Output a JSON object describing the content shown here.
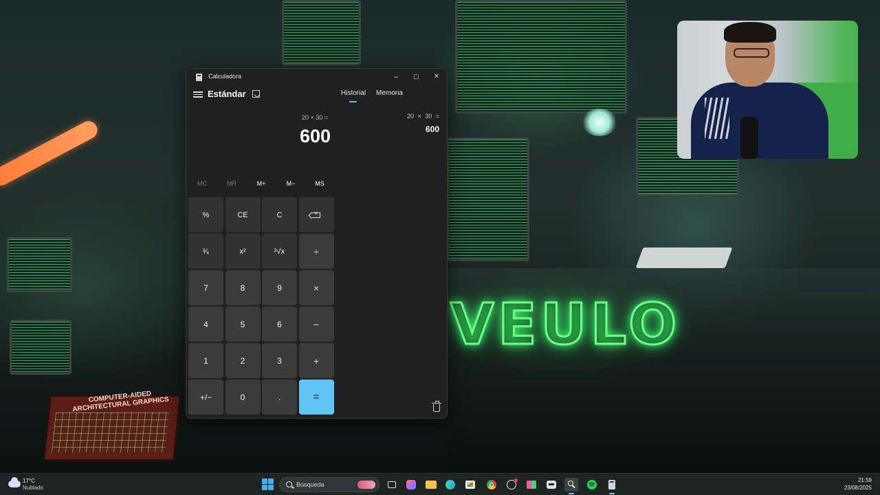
{
  "calculator": {
    "window_title": "Calculadora",
    "window_controls": {
      "minimize": "–",
      "maximize": "☐",
      "close": "✕"
    },
    "mode": "Estándar",
    "tabs": [
      {
        "label": "Historial",
        "active": true
      },
      {
        "label": "Memoria",
        "active": false
      }
    ],
    "expression": "20 × 30 =",
    "display_value": "600",
    "history": [
      {
        "expression": "20 × 30 =",
        "result": "600"
      }
    ],
    "memory_buttons": [
      {
        "label": "MC",
        "enabled": false
      },
      {
        "label": "MR",
        "enabled": false
      },
      {
        "label": "M+",
        "enabled": true
      },
      {
        "label": "M−",
        "enabled": true
      },
      {
        "label": "MS",
        "enabled": true
      }
    ],
    "keys": [
      {
        "label": "%",
        "name": "percent-key",
        "kind": "func"
      },
      {
        "label": "CE",
        "name": "clear-entry-key",
        "kind": "func"
      },
      {
        "label": "C",
        "name": "clear-key",
        "kind": "func"
      },
      {
        "label": "",
        "name": "backspace-key",
        "kind": "func",
        "icon": "backspace-icon"
      },
      {
        "label": "¹⁄ₓ",
        "name": "reciprocal-key",
        "kind": "func"
      },
      {
        "label": "x²",
        "name": "square-key",
        "kind": "func"
      },
      {
        "label": "²√x",
        "name": "square-root-key",
        "kind": "func"
      },
      {
        "label": "÷",
        "name": "divide-key",
        "kind": "op"
      },
      {
        "label": "7",
        "name": "digit-7-key",
        "kind": "num"
      },
      {
        "label": "8",
        "name": "digit-8-key",
        "kind": "num"
      },
      {
        "label": "9",
        "name": "digit-9-key",
        "kind": "num"
      },
      {
        "label": "×",
        "name": "multiply-key",
        "kind": "op"
      },
      {
        "label": "4",
        "name": "digit-4-key",
        "kind": "num"
      },
      {
        "label": "5",
        "name": "digit-5-key",
        "kind": "num"
      },
      {
        "label": "6",
        "name": "digit-6-key",
        "kind": "num"
      },
      {
        "label": "−",
        "name": "subtract-key",
        "kind": "op"
      },
      {
        "label": "1",
        "name": "digit-1-key",
        "kind": "num"
      },
      {
        "label": "2",
        "name": "digit-2-key",
        "kind": "num"
      },
      {
        "label": "3",
        "name": "digit-3-key",
        "kind": "num"
      },
      {
        "label": "+",
        "name": "add-key",
        "kind": "op"
      },
      {
        "label": "+/−",
        "name": "negate-key",
        "kind": "num"
      },
      {
        "label": "0",
        "name": "digit-0-key",
        "kind": "num"
      },
      {
        "label": ".",
        "name": "decimal-key",
        "kind": "num"
      },
      {
        "label": "=",
        "name": "equals-key",
        "kind": "equals"
      }
    ],
    "accent_color": "#60c4f4"
  },
  "wallpaper": {
    "neon_text": "VEULO",
    "book_title": "COMPUTER-AIDED ARCHITECTURAL GRAPHICS"
  },
  "taskbar": {
    "weather": {
      "temp": "17°C",
      "desc": "Nublado",
      "icon": "cloud-icon"
    },
    "search_placeholder": "Búsqueda",
    "pinned_icons": [
      "task-view-icon",
      "copilot-icon",
      "file-explorer-icon",
      "edge-icon",
      "store-icon",
      "chrome-icon",
      "github-icon",
      "greenshot-icon",
      "ai-app-icon",
      "search-app-icon",
      "spotify-icon",
      "calculator-icon"
    ],
    "clock_time": "21:59",
    "clock_date": "23/08/2025"
  }
}
